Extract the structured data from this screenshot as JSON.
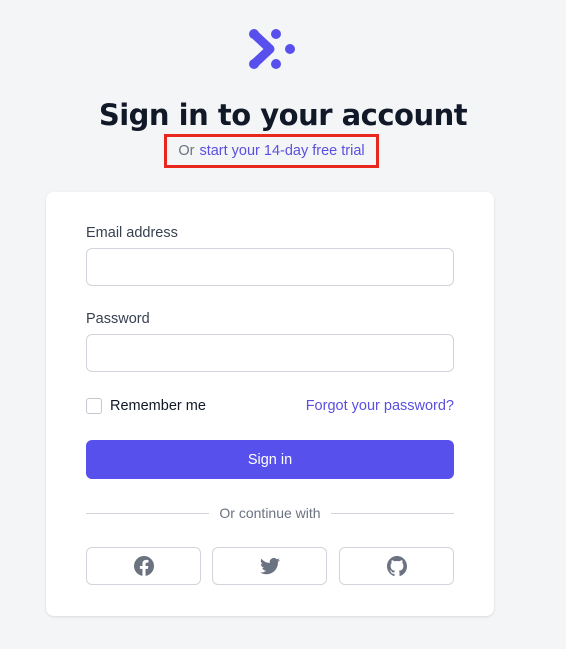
{
  "colors": {
    "accent": "#5850ec",
    "link": "#5b4fe0",
    "highlight_box": "#e8281c",
    "background": "#f4f5f7"
  },
  "header": {
    "logo_icon": "brand-logo-icon",
    "title": "Sign in to your account",
    "subtitle_prefix": "Or",
    "trial_link": "start your 14-day free trial"
  },
  "form": {
    "email_label": "Email address",
    "email_value": "",
    "password_label": "Password",
    "password_value": "",
    "remember_label": "Remember me",
    "remember_checked": false,
    "forgot_link": "Forgot your password?",
    "submit_label": "Sign in"
  },
  "social": {
    "divider_text": "Or continue with",
    "providers": [
      {
        "name": "Facebook",
        "icon": "facebook-icon"
      },
      {
        "name": "Twitter",
        "icon": "twitter-icon"
      },
      {
        "name": "GitHub",
        "icon": "github-icon"
      }
    ]
  }
}
